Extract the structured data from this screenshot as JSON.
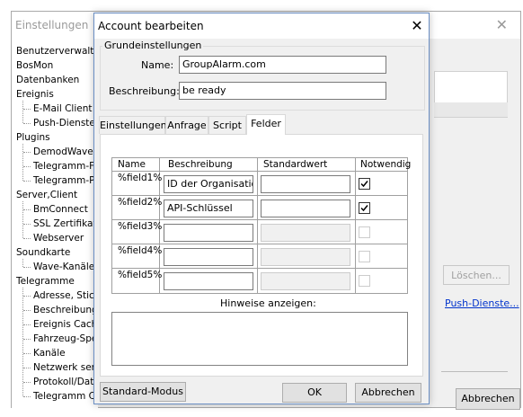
{
  "background_window": {
    "title": "Einstellungen",
    "close_glyph": "✕",
    "tree": [
      {
        "label": "Benutzerverwaltung",
        "level": 0
      },
      {
        "label": "BosMon",
        "level": 0
      },
      {
        "label": "Datenbanken",
        "level": 0
      },
      {
        "label": "Ereignis",
        "level": 0
      },
      {
        "label": "E-Mail Client",
        "level": 1
      },
      {
        "label": "Push-Dienste",
        "level": 1
      },
      {
        "label": "Plugins",
        "level": 0
      },
      {
        "label": "DemodWaveEx",
        "level": 1
      },
      {
        "label": "Telegramm-Fe",
        "level": 1
      },
      {
        "label": "Telegramm-Po",
        "level": 1
      },
      {
        "label": "Server,Client",
        "level": 0
      },
      {
        "label": "BmConnect",
        "level": 1
      },
      {
        "label": "SSL Zertifikat",
        "level": 1
      },
      {
        "label": "Webserver",
        "level": 1
      },
      {
        "label": "Soundkarte",
        "level": 0
      },
      {
        "label": "Wave-Kanäle",
        "level": 1
      },
      {
        "label": "Telegramme",
        "level": 0
      },
      {
        "label": "Adresse, Stich",
        "level": 1
      },
      {
        "label": "Beschreibunge",
        "level": 1
      },
      {
        "label": "Ereignis Cache",
        "level": 1
      },
      {
        "label": "Fahrzeug-Spe",
        "level": 1
      },
      {
        "label": "Kanäle",
        "level": 1
      },
      {
        "label": "Netzwerk send",
        "level": 1
      },
      {
        "label": "Protokoll/Date",
        "level": 1
      },
      {
        "label": "Telegramm Ca",
        "level": 1
      }
    ],
    "loeschen_label": "Löschen...",
    "push_link": "Push-Dienste...",
    "abbrechen_label": "Abbrechen"
  },
  "dialog": {
    "title": "Account bearbeiten",
    "close_glyph": "✕",
    "group_title": "Grundeinstellungen",
    "name_label": "Name:",
    "name_value": "GroupAlarm.com",
    "desc_label": "Beschreibung:",
    "desc_value": "be ready",
    "tabs": [
      "Einstellungen",
      "Anfrage",
      "Script",
      "Felder"
    ],
    "active_tab": "Felder",
    "grid": {
      "headers": [
        "Name",
        "Beschreibung",
        "Standardwert",
        "Notwendig"
      ],
      "rows": [
        {
          "name": "%field1%",
          "beschreibung": "ID der Organisation",
          "standardwert": "",
          "notwendig": true,
          "enabled": true
        },
        {
          "name": "%field2%",
          "beschreibung": "API-Schlüssel",
          "standardwert": "",
          "notwendig": true,
          "enabled": true
        },
        {
          "name": "%field3%",
          "beschreibung": "",
          "standardwert": "",
          "notwendig": false,
          "enabled": false
        },
        {
          "name": "%field4%",
          "beschreibung": "",
          "standardwert": "",
          "notwendig": false,
          "enabled": false
        },
        {
          "name": "%field5%",
          "beschreibung": "",
          "standardwert": "",
          "notwendig": false,
          "enabled": false
        }
      ]
    },
    "hint_label": "Hinweise anzeigen:",
    "hint_text": "",
    "buttons": {
      "standard_mode": "Standard-Modus",
      "ok": "OK",
      "cancel": "Abbrechen"
    }
  }
}
